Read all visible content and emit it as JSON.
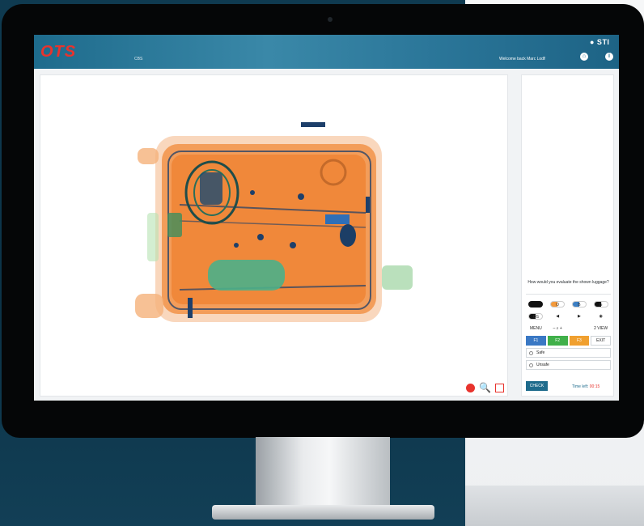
{
  "app": {
    "logo": "OTS",
    "module_label": "CBS",
    "brand": "● STI",
    "welcome": "Welcome back Marc Lodl!",
    "home_icon": "home-icon",
    "info_icon": "info-icon"
  },
  "viewer": {
    "image_kind": "x-ray scan of a suitcase",
    "tools": [
      "record-dot-icon",
      "magnifier-icon",
      "selection-box-icon"
    ]
  },
  "panel": {
    "question": "How would you evaluate the shown luggage?",
    "controls": [
      {
        "label": "",
        "kind": "pill-k"
      },
      {
        "label": "O",
        "kind": "pill-o"
      },
      {
        "label": "B",
        "kind": "pill-b"
      },
      {
        "label": "G",
        "kind": "pill-g"
      },
      {
        "label": "OS",
        "kind": "pill-g"
      },
      {
        "label": "◀",
        "kind": "arrow"
      },
      {
        "label": "▶",
        "kind": "arrow"
      },
      {
        "label": "◉",
        "kind": "eye"
      },
      {
        "label": "MENU",
        "kind": "text"
      },
      {
        "label": "– ⌕ +",
        "kind": "text"
      },
      {
        "label": "",
        "kind": "blank"
      },
      {
        "label": "2 VIEW",
        "kind": "text"
      }
    ],
    "fkeys": [
      "F1",
      "F2",
      "F3",
      "EXIT"
    ],
    "options": [
      "Safe",
      "Unsafe"
    ],
    "check_label": "CHECK",
    "time_label": "Time left:",
    "time_value": "00:15"
  },
  "colors": {
    "header": "#1e6b8c",
    "logo": "#e8332d",
    "f1": "#3a78c4",
    "f2": "#40b04a",
    "f3": "#f0a030"
  }
}
